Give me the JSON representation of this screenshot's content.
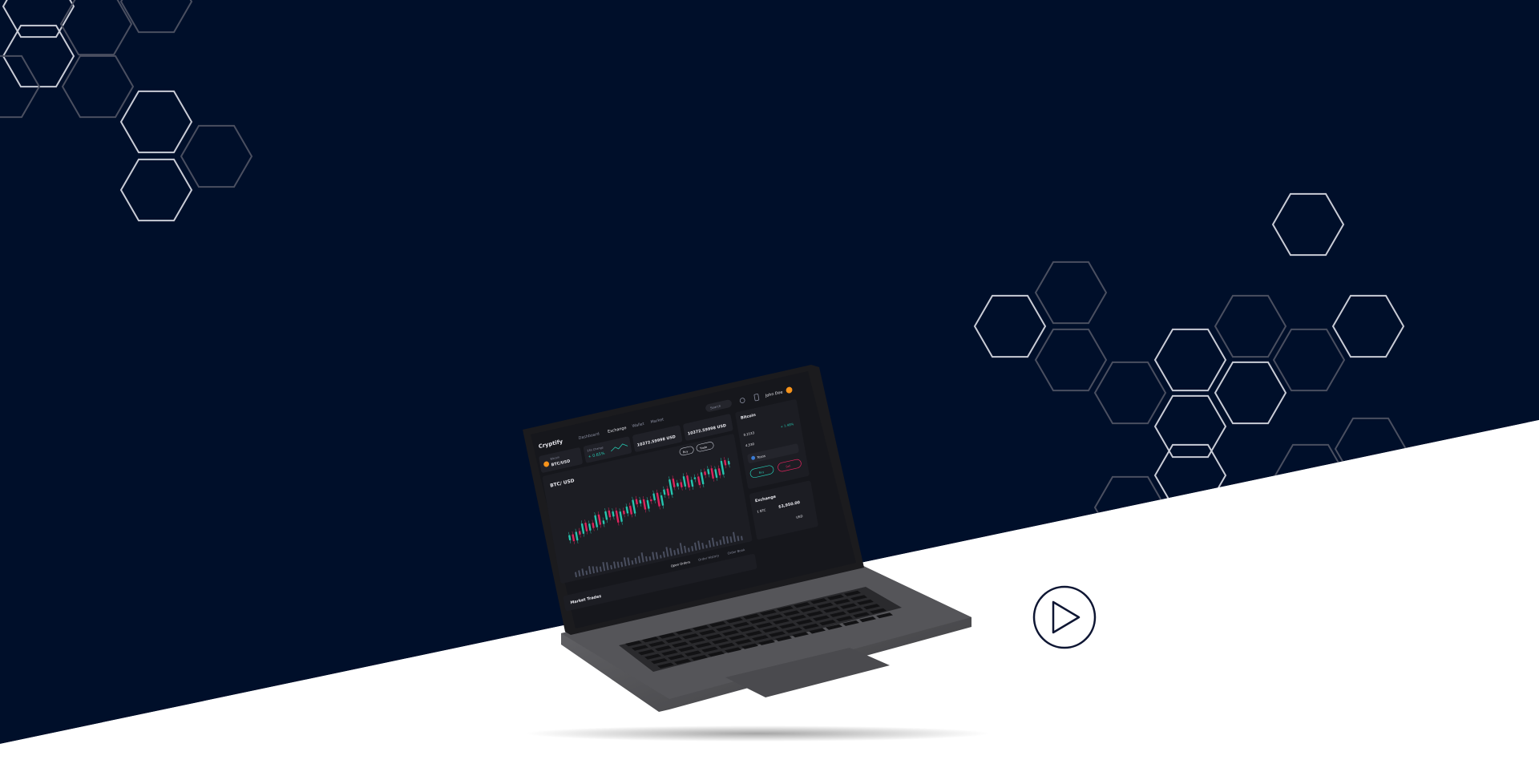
{
  "colors": {
    "navy": "#000f2a",
    "white": "#ffffff",
    "hex_light": "#c9ccd6",
    "hex_dim": "#4a4f60",
    "candle_up": "#26c6b0",
    "candle_down": "#e0245e",
    "accent_orange": "#f7931a"
  },
  "screen": {
    "brand": "Cryptify",
    "nav": [
      "Dashboard",
      "Exchange",
      "Wallet",
      "Market"
    ],
    "search_placeholder": "Search",
    "user_name": "John Doe",
    "pair_label": "Bitcoin",
    "pair": "BTC/USD",
    "change_label": "24h Change",
    "change_value": "+ 0.65%",
    "stat_1_value": "10372.59998 USD",
    "stat_2_value": "10372.59998 USD",
    "btn_buy": "Buy",
    "btn_trade": "Trade",
    "chart_title": "BTC/ USD",
    "tab_open_orders": "Open Orders",
    "tab_order_history": "Order History",
    "tab_order_book": "Order Book",
    "market_trades": "Market Trades",
    "side_title": "Bitcoin",
    "side_balance": "+ 1.49%",
    "side_amount": "0.2133",
    "side_usd": "4,530",
    "currency": "Tezos",
    "sell": "Sell",
    "buy": "Buy",
    "exchange_title": "Exchange",
    "exchange_from": "1 BTC",
    "exchange_to": "$3,950.00",
    "exchange_currency": "USD"
  },
  "play_icon": "play-icon"
}
